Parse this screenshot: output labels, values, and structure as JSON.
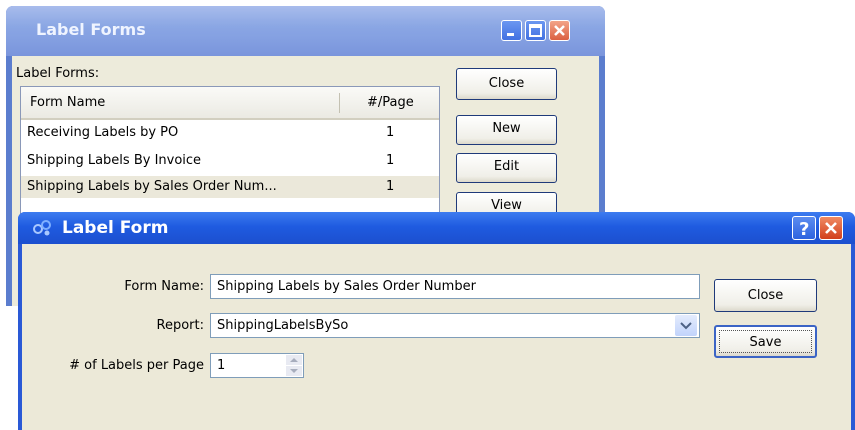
{
  "back_window": {
    "title": "Label Forms",
    "list_label": "Label Forms:",
    "columns": [
      "Form Name",
      "#/Page"
    ],
    "rows": [
      {
        "name": "Receiving Labels by PO",
        "per_page": "1"
      },
      {
        "name": "Shipping Labels By Invoice",
        "per_page": "1"
      },
      {
        "name": "Shipping Labels by Sales Order Num...",
        "per_page": "1"
      }
    ],
    "buttons": {
      "close": "Close",
      "new": "New",
      "edit": "Edit",
      "view": "View"
    }
  },
  "front_window": {
    "title": "Label Form",
    "form_name_label": "Form Name:",
    "form_name_value": "Shipping Labels by Sales Order Number",
    "report_label": "Report:",
    "report_value": "ShippingLabelsBySo",
    "labels_per_page_label": "# of Labels per Page",
    "labels_per_page_value": "1",
    "buttons": {
      "close": "Close",
      "save": "Save"
    }
  },
  "colors": {
    "xp_blue": "#2a59d6",
    "close_red": "#d23f1c",
    "dialog_bg": "#ece9d8"
  },
  "icons": [
    "minimize-icon",
    "maximize-icon",
    "close-icon",
    "help-icon",
    "app-icon",
    "dropdown-arrow-icon",
    "spin-arrows-icon"
  ]
}
